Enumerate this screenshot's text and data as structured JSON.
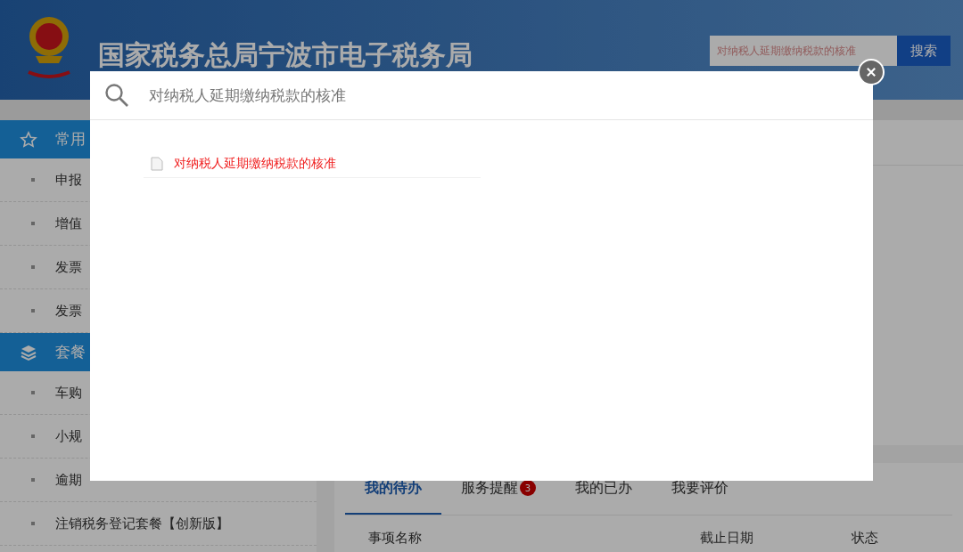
{
  "header": {
    "title": "国家税务总局宁波市电子税务局",
    "search": {
      "value": "对纳税人延期缴纳税款的核准"
    },
    "search_button": "搜索"
  },
  "sidebar": {
    "groups": [
      {
        "label": "常用",
        "items": [
          "申报",
          "增值",
          "发票",
          "发票"
        ]
      },
      {
        "label": "套餐",
        "items": [
          "车购",
          "小规",
          "逾期",
          "注销税务登记套餐【创新版】"
        ]
      }
    ]
  },
  "tabs": [
    {
      "label": "我的待办",
      "selected": true
    },
    {
      "label": "服务提醒",
      "selected": false,
      "badge": "3"
    },
    {
      "label": "我的已办",
      "selected": false
    },
    {
      "label": "我要评价",
      "selected": false
    }
  ],
  "table": {
    "columns": [
      "事项名称",
      "截止日期",
      "状态"
    ]
  },
  "dialog": {
    "search": {
      "value": "对纳税人延期缴纳税款的核准"
    },
    "results": [
      {
        "title": "对纳税人延期缴纳税款的核准"
      }
    ]
  }
}
